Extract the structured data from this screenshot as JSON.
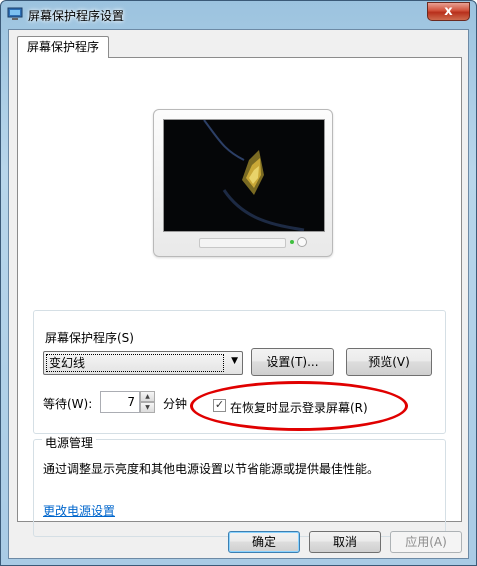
{
  "window": {
    "title": "屏幕保护程序设置",
    "close_label": "x"
  },
  "tabs": [
    {
      "label": "屏幕保护程序"
    }
  ],
  "screensaver_group": {
    "label": "屏幕保护程序(S)",
    "selected": "变幻线",
    "settings_button": "设置(T)...",
    "preview_button": "预览(V)",
    "wait_label": "等待(W):",
    "wait_value": "7",
    "minutes_label": "分钟",
    "resume_checkbox_label": "在恢复时显示登录屏幕(R)",
    "resume_checked": true
  },
  "power_group": {
    "label": "电源管理",
    "description": "通过调整显示亮度和其他电源设置以节省能源或提供最佳性能。",
    "link": "更改电源设置"
  },
  "footer": {
    "ok": "确定",
    "cancel": "取消",
    "apply": "应用(A)"
  },
  "colors": {
    "annotation_ellipse": "#e00000",
    "link": "#0066cc"
  }
}
